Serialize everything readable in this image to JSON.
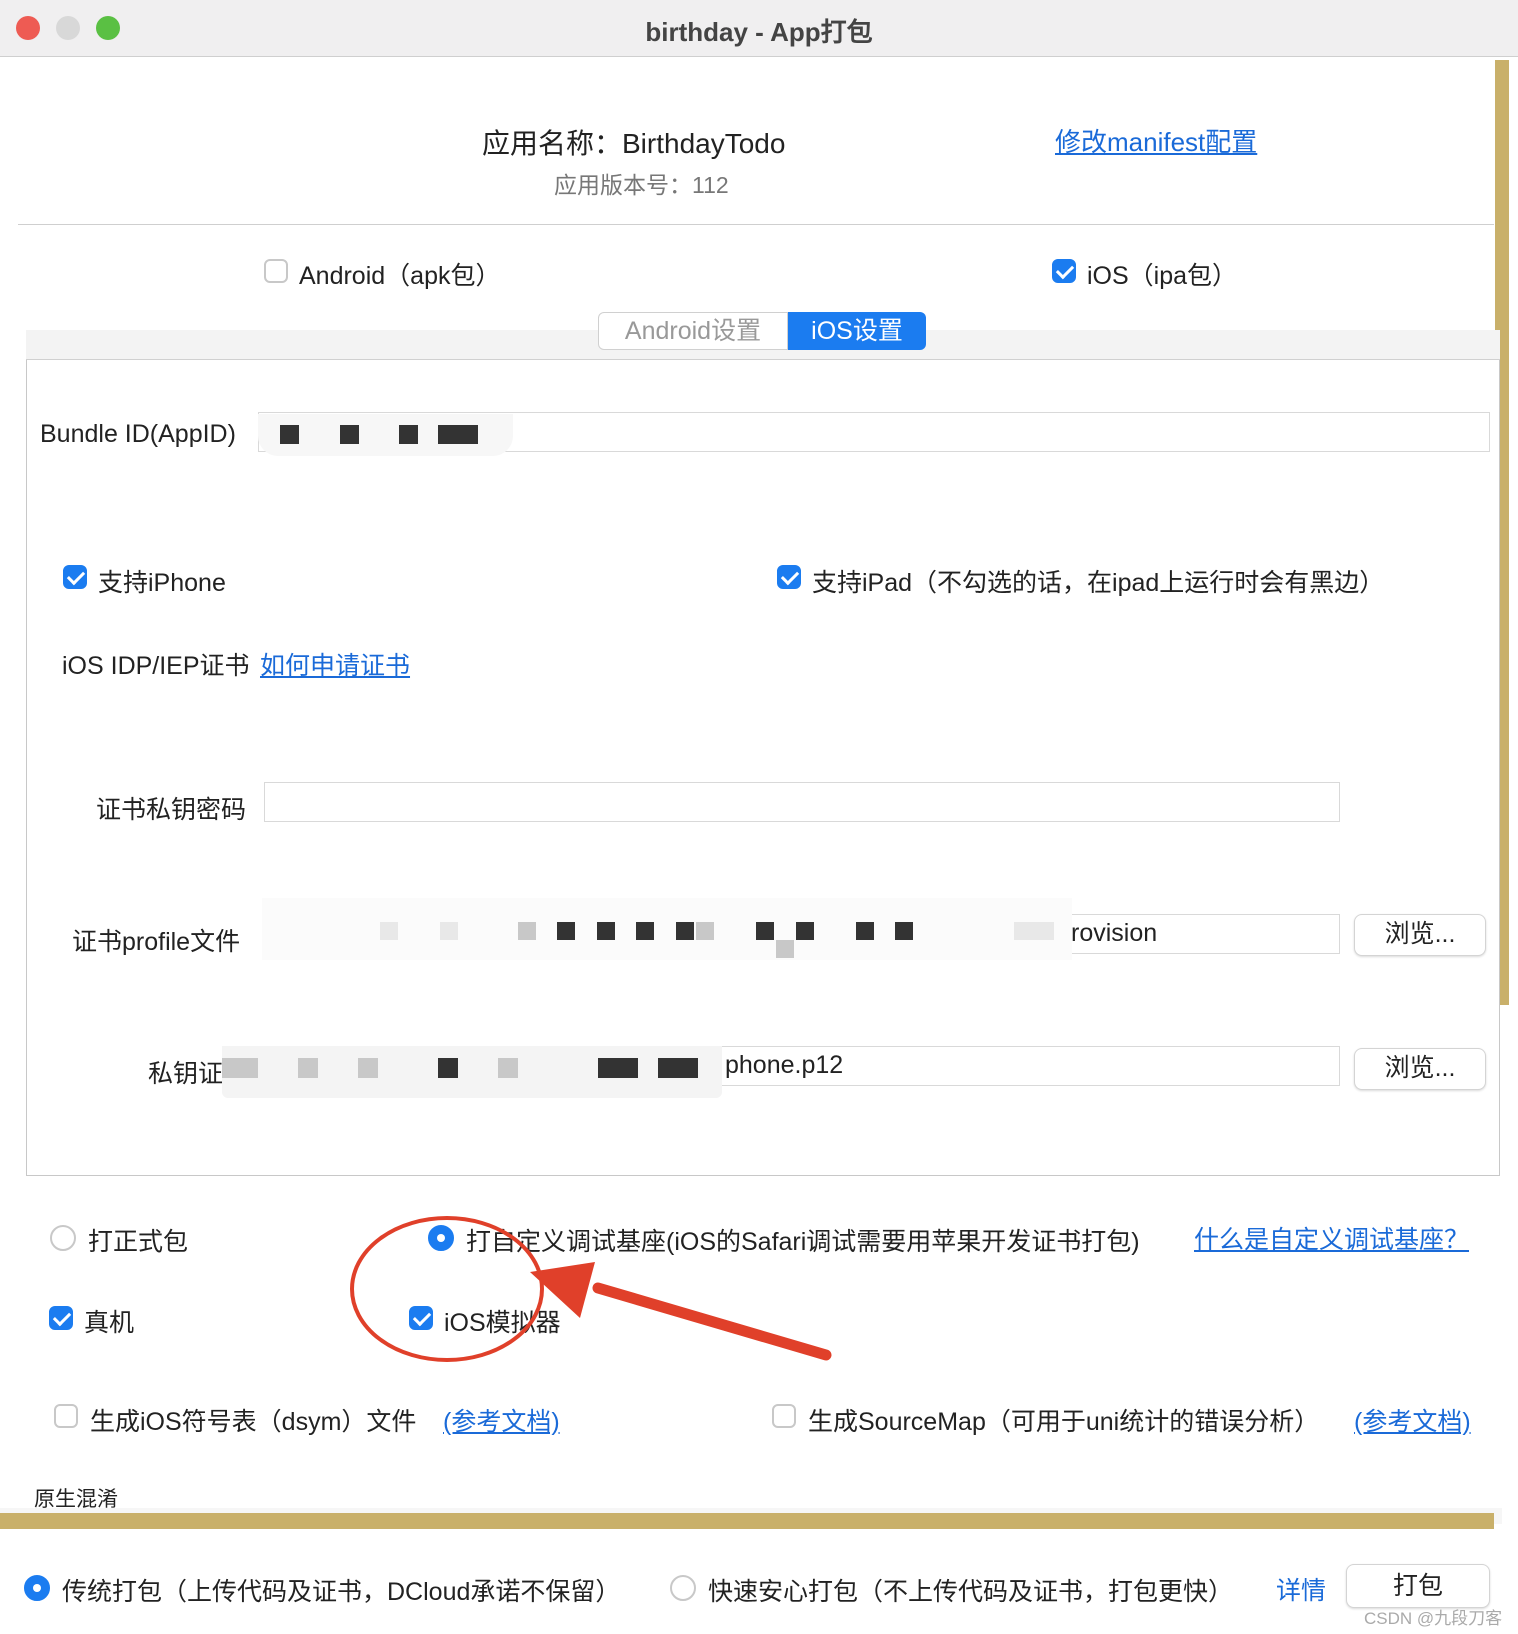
{
  "window": {
    "title": "birthday - App打包"
  },
  "header": {
    "app_name": "应用名称：BirthdayTodo",
    "app_version": "应用版本号：112",
    "manifest_link": "修改manifest配置"
  },
  "platforms": {
    "android_label": "Android（apk包）",
    "android_checked": false,
    "ios_label": "iOS（ipa包）",
    "ios_checked": true
  },
  "tabs": [
    {
      "label": "Android设置",
      "active": false
    },
    {
      "label": "iOS设置",
      "active": true
    }
  ],
  "ios_settings": {
    "bundle_id_label": "Bundle ID(AppID)",
    "support_iphone_label": "支持iPhone",
    "support_iphone_checked": true,
    "support_ipad_label": "支持iPad（不勾选的话，在ipad上运行时会有黑边）",
    "support_ipad_checked": true,
    "cert_label": "iOS IDP/IEP证书",
    "cert_link": "如何申请证书",
    "cert_password_label": "证书私钥密码",
    "cert_password_value": "",
    "profile_label": "证书profile文件",
    "profile_value_suffix": "rovision",
    "private_key_label": "私钥证书",
    "private_key_value_suffix": "phone.p12",
    "browse_label": "浏览..."
  },
  "build_options": {
    "formal_label": "打正式包",
    "formal_selected": false,
    "custom_base_label": "打自定义调试基座(iOS的Safari调试需要用苹果开发证书打包)",
    "custom_base_selected": true,
    "custom_base_link": "什么是自定义调试基座？",
    "device_label": "真机",
    "device_checked": true,
    "simulator_label": "iOS模拟器",
    "simulator_checked": true,
    "dsym_label": "生成iOS符号表（dsym）文件",
    "dsym_checked": false,
    "dsym_link": "(参考文档)",
    "sourcemap_label": "生成SourceMap（可用于uni统计的错误分析）",
    "sourcemap_checked": false,
    "sourcemap_link": "(参考文档)",
    "obfuscation_label": "原生混淆"
  },
  "footer": {
    "traditional_label": "传统打包（上传代码及证书，DCloud承诺不保留）",
    "traditional_selected": true,
    "fast_label": "快速安心打包（不上传代码及证书，打包更快）",
    "fast_selected": false,
    "details_link": "详情",
    "build_button": "打包"
  },
  "watermark": "CSDN @九段刀客",
  "colors": {
    "accent": "#1b7cf0",
    "link": "#1a6ad8",
    "annotation_red": "#e0402a",
    "scrollbar": "#c9b06a"
  }
}
